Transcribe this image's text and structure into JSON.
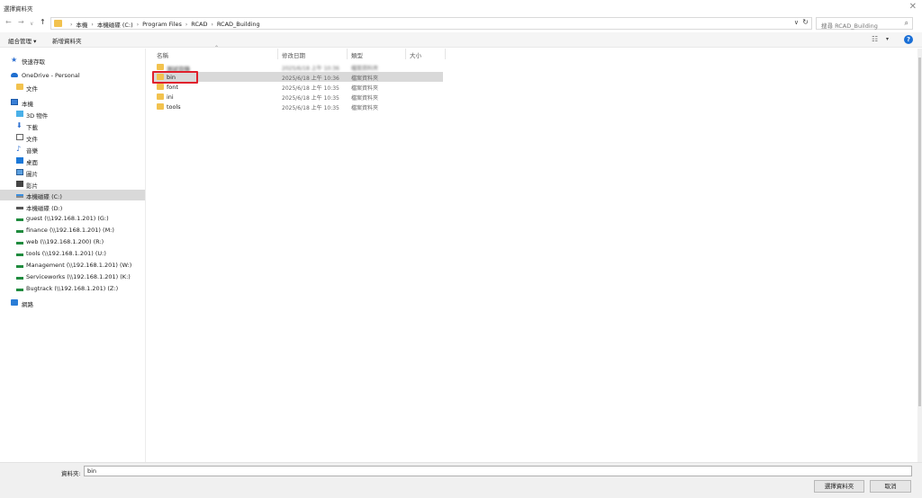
{
  "window": {
    "title": "選擇資料夾"
  },
  "address": {
    "crumbs": [
      "本機",
      "本機磁碟 (C:)",
      "Program Files",
      "RCAD",
      "RCAD_Building"
    ],
    "search_placeholder": "搜尋 RCAD_Building"
  },
  "commands": {
    "organize": "組合管理 ▾",
    "new_folder": "新增資料夾"
  },
  "nav": {
    "quick_access": "快速存取",
    "onedrive": "OneDrive - Personal",
    "onedrive_docs": "文件",
    "this_pc": "本機",
    "objects3d": "3D 物件",
    "downloads": "下載",
    "documents": "文件",
    "music": "音樂",
    "desktop": "桌面",
    "pictures": "圖片",
    "videos": "影片",
    "drive_c": "本機磁碟 (C:)",
    "drive_d": "本機磁碟 (D:)",
    "net_g": "guest (\\\\192.168.1.201) (G:)",
    "net_m": "finance (\\\\192.168.1.201) (M:)",
    "net_r": "web (\\\\192.168.1.200) (R:)",
    "net_u": "tools (\\\\192.168.1.201) (U:)",
    "net_w": "Management (\\\\192.168.1.201) (W:)",
    "net_k": "Serviceworks (\\\\192.168.1.201) (K:)",
    "net_z": "Bugtrack (\\\\192.168.1.201) (Z:)",
    "network": "網路"
  },
  "columns": {
    "name": "名稱",
    "date": "修改日期",
    "type": "類型",
    "size": "大小"
  },
  "files": [
    {
      "name": "測試目錄",
      "date": "2025/6/18 上午 10:36",
      "type": "檔案資料夾"
    },
    {
      "name": "bin",
      "date": "2025/6/18 上午 10:36",
      "type": "檔案資料夾"
    },
    {
      "name": "font",
      "date": "2025/6/18 上午 10:35",
      "type": "檔案資料夾"
    },
    {
      "name": "ini",
      "date": "2025/6/18 上午 10:35",
      "type": "檔案資料夾"
    },
    {
      "name": "tools",
      "date": "2025/6/18 上午 10:35",
      "type": "檔案資料夾"
    }
  ],
  "bottom": {
    "folder_label": "資料夾:",
    "folder_value": "bin",
    "select_button": "選擇資料夾",
    "cancel_button": "取消"
  },
  "colors": {
    "highlight": "#e0202c",
    "folder": "#f2c24e",
    "accent": "#1a6fd6"
  }
}
